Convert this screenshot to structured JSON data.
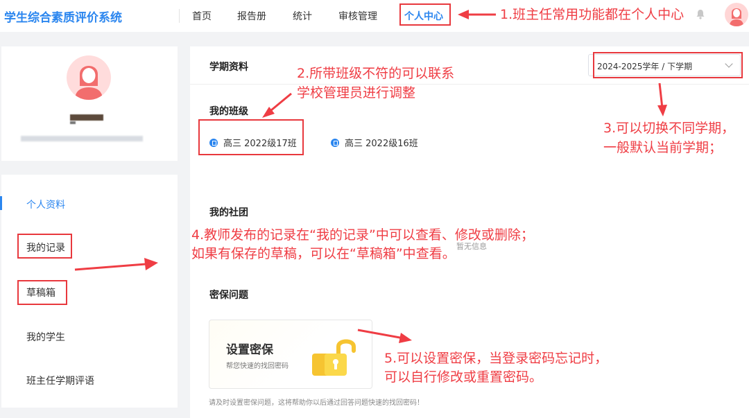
{
  "app": {
    "title": "学生综合素质评价系统"
  },
  "nav": {
    "items": [
      {
        "label": "首页"
      },
      {
        "label": "报告册"
      },
      {
        "label": "统计"
      },
      {
        "label": "审核管理"
      },
      {
        "label": "个人中心"
      }
    ]
  },
  "sidebar": {
    "items": [
      {
        "label": "个人资料"
      },
      {
        "label": "我的记录"
      },
      {
        "label": "草稿箱"
      },
      {
        "label": "我的学生"
      },
      {
        "label": "班主任学期评语"
      }
    ]
  },
  "main": {
    "semester_title": "学期资料",
    "semester_select": "2024-2025学年 / 下学期",
    "classes_title": "我的班级",
    "classes": [
      {
        "label": "高三 2022级17班"
      },
      {
        "label": "高三 2022级16班"
      }
    ],
    "clubs_title": "我的社团",
    "clubs_empty": "暂无信息",
    "security_title": "密保问题",
    "security_card_title": "设置密保",
    "security_card_sub": "帮您快速的找回密码",
    "security_tip": "请及时设置密保问题，这将帮助你以后通过回答问题快速的找回密码！"
  },
  "annotations": {
    "note1": "1.班主任常用功能都在个人中心",
    "note2_line1": "2.所带班级不符的可以联系",
    "note2_line2": "学校管理员进行调整",
    "note3_line1": "3.可以切换不同学期，",
    "note3_line2": "一般默认当前学期；",
    "note4_line1": "4.教师发布的记录在“我的记录”中可以查看、修改或删除；",
    "note4_line2": "如果有保存的草稿，可以在“草稿箱”中查看。",
    "note5_line1": "5.可以设置密保，当登录密码忘记时，",
    "note5_line2": "可以自行修改或重置密码。",
    "color": "#ef3d44"
  },
  "colors": {
    "accent": "#2b86ef",
    "annotation": "#e8383d",
    "background": "#f2f3f5"
  }
}
